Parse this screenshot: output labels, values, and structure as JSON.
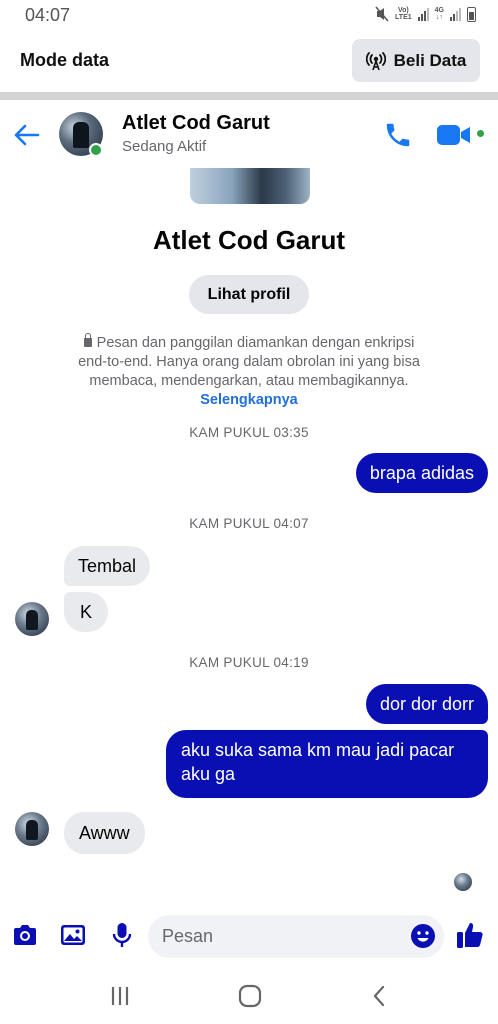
{
  "status_bar": {
    "time": "04:07",
    "volte_line1": "Vo)",
    "volte_line2": "LTE1",
    "net_line1": "4G",
    "net_line2": "↓↑"
  },
  "data_banner": {
    "title": "Mode data",
    "buy_label": "Beli Data"
  },
  "chat_header": {
    "name": "Atlet Cod Garut",
    "status": "Sedang Aktif"
  },
  "profile_intro": {
    "name": "Atlet Cod Garut",
    "profile_button": "Lihat profil",
    "encryption_text": "Pesan dan panggilan diamankan dengan enkripsi end-to-end. Hanya orang dalam obrolan ini yang bisa membaca, mendengarkan, atau membagikannya.",
    "encryption_link": "Selengkapnya"
  },
  "timestamps": {
    "t1": "KAM PUKUL 03:35",
    "t2": "KAM PUKUL 04:07",
    "t3": "KAM PUKUL 04:19"
  },
  "messages": [
    {
      "from": "me",
      "text": "brapa adidas"
    },
    {
      "from": "them",
      "text": "Tembal"
    },
    {
      "from": "them",
      "text": "K"
    },
    {
      "from": "me",
      "text": "dor dor dorr"
    },
    {
      "from": "me",
      "text": "aku suka sama km mau jadi pacar aku ga"
    },
    {
      "from": "them",
      "text": "Awww"
    }
  ],
  "composer": {
    "placeholder": "Pesan"
  },
  "colors": {
    "accent_blue": "#1877f2",
    "outgoing_bubble": "#0a0fb4",
    "incoming_bubble": "#e9eaee",
    "online_green": "#31a24c"
  }
}
